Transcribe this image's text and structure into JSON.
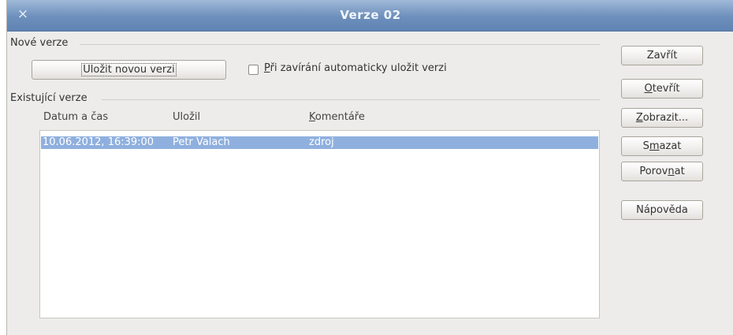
{
  "window": {
    "title": "Verze 02",
    "close_glyph": "×"
  },
  "new_versions": {
    "section_label": "Nové verze",
    "save_button": "Uložit novou verzi",
    "auto_save_label_u": "P",
    "auto_save_label_rest": "ři zavírání automaticky uložit verzi",
    "auto_save_checked": false
  },
  "existing_versions": {
    "section_label": "Existující verze",
    "columns": {
      "datetime": "Datum a čas",
      "saved_by": "Uložil",
      "comments_u": "K",
      "comments_rest": "omentáře"
    },
    "rows": [
      {
        "datetime": "10.06.2012, 16:39:00",
        "saved_by": "Petr Valach",
        "comment": "zdroj"
      }
    ]
  },
  "buttons": {
    "close": "Zavřít",
    "open_u": "O",
    "open_rest": "tevřít",
    "show_u": "Z",
    "show_rest": "obrazit...",
    "delete_pre": "S",
    "delete_u": "m",
    "delete_rest": "azat",
    "compare_pre": "Porov",
    "compare_u": "n",
    "compare_rest": "at",
    "help": "Nápověda"
  },
  "colors": {
    "titlebar": "#6d8fbb",
    "selection": "#8fb0de",
    "dialog_bg": "#edeceb"
  }
}
